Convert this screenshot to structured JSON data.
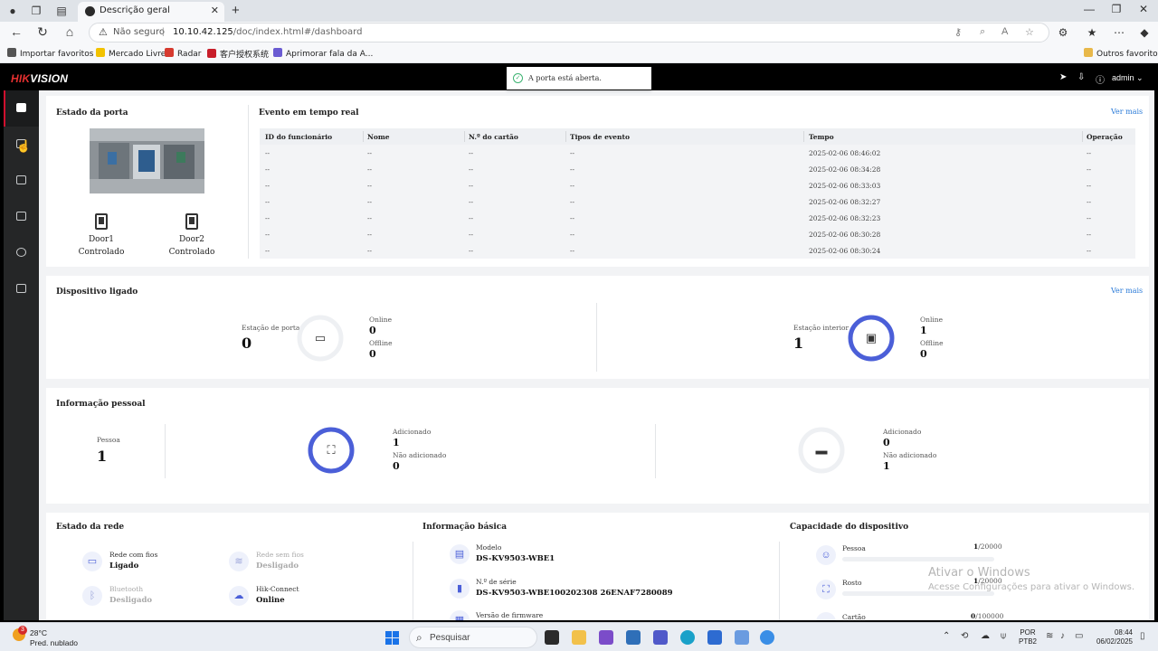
{
  "browser": {
    "tab_title": "Descrição geral",
    "security_label": "Não seguro",
    "url_host": "10.10.42.125",
    "url_path": "/doc/index.html#/dashboard",
    "favorites": [
      {
        "label": "Importar favoritos",
        "color": "#555555"
      },
      {
        "label": "Mercado Livre",
        "color": "#f2c200"
      },
      {
        "label": "Radar",
        "color": "#d63a2f"
      },
      {
        "label": "客户授权系统",
        "color": "#c81e2a"
      },
      {
        "label": "Aprimorar fala da A...",
        "color": "#6a5bd2"
      }
    ],
    "other_favorites": "Outros favoritos"
  },
  "app": {
    "brand_red": "HIK",
    "brand_white": "VISION",
    "user": "admin",
    "toast": "A porta está aberta.",
    "door_status": {
      "title": "Estado da porta",
      "doors": [
        {
          "name": "Door1",
          "status": "Controlado"
        },
        {
          "name": "Door2",
          "status": "Controlado"
        }
      ]
    },
    "events": {
      "title": "Evento em tempo real",
      "more": "Ver mais",
      "columns": [
        "ID do funcionário",
        "Nome",
        "N.º do cartão",
        "Tipos de evento",
        "Tempo",
        "Operação"
      ],
      "rows": [
        [
          "--",
          "--",
          "--",
          "--",
          "2025-02-06 08:46:02",
          "--"
        ],
        [
          "--",
          "--",
          "--",
          "--",
          "2025-02-06 08:34:28",
          "--"
        ],
        [
          "--",
          "--",
          "--",
          "--",
          "2025-02-06 08:33:03",
          "--"
        ],
        [
          "--",
          "--",
          "--",
          "--",
          "2025-02-06 08:32:27",
          "--"
        ],
        [
          "--",
          "--",
          "--",
          "--",
          "2025-02-06 08:32:23",
          "--"
        ],
        [
          "--",
          "--",
          "--",
          "--",
          "2025-02-06 08:30:28",
          "--"
        ],
        [
          "--",
          "--",
          "--",
          "--",
          "2025-02-06 08:30:24",
          "--"
        ]
      ]
    },
    "devices": {
      "title": "Dispositivo ligado",
      "more": "Ver mais",
      "door_station": {
        "label": "Estação de porta",
        "total": "0",
        "online_label": "Online",
        "online": "0",
        "offline_label": "Offline",
        "offline": "0",
        "online_fraction": 0
      },
      "indoor_station": {
        "label": "Estação interior",
        "total": "1",
        "online_label": "Online",
        "online": "1",
        "offline_label": "Offline",
        "offline": "0",
        "online_fraction": 1
      }
    },
    "persons": {
      "title": "Informação pessoal",
      "person_label": "Pessoa",
      "person_count": "1",
      "face": {
        "added_label": "Adicionado",
        "added": "1",
        "not_added_label": "Não adicionado",
        "not_added": "0",
        "added_fraction": 1
      },
      "card": {
        "added_label": "Adicionado",
        "added": "0",
        "not_added_label": "Não adicionado",
        "not_added": "1",
        "added_fraction": 0
      }
    },
    "network": {
      "title": "Estado da rede",
      "items": [
        {
          "name": "Rede com fios",
          "status": "Ligado",
          "active": true
        },
        {
          "name": "Rede sem fios",
          "status": "Desligado",
          "active": false
        },
        {
          "name": "Bluetooth",
          "status": "Desligado",
          "active": false
        },
        {
          "name": "Hik-Connect",
          "status": "Online",
          "active": true
        }
      ]
    },
    "basic_info": {
      "title": "Informação básica",
      "model_label": "Modelo",
      "model": "DS-KV9503-WBE1",
      "serial_label": "N.º de série",
      "serial": "DS-KV9503-WBE100202308 26ENAF7280089",
      "firmware_label": "Versão de firmware"
    },
    "capacity": {
      "title": "Capacidade do dispositivo",
      "items": [
        {
          "label": "Pessoa",
          "used": "1",
          "total": "/20000",
          "fraction": 5e-05
        },
        {
          "label": "Rosto",
          "used": "1",
          "total": "/20000",
          "fraction": 5e-05
        },
        {
          "label": "Cartão",
          "used": "0",
          "total": "/100000",
          "fraction": 0
        }
      ]
    },
    "watermark_line1": "Ativar o Windows",
    "watermark_line2": "Acesse Configurações para ativar o Windows."
  },
  "taskbar": {
    "weather_badge": "3",
    "temperature": "28°C",
    "weather_desc": "Pred. nublado",
    "search_placeholder": "Pesquisar",
    "lang_line1": "POR",
    "lang_line2": "PTB2",
    "time": "08:44",
    "date": "06/02/2025"
  },
  "colors": {
    "accent": "#4b5fd8",
    "brand_red": "#c8102e",
    "link": "#2b7bd8",
    "toast_ok": "#3cb371"
  }
}
